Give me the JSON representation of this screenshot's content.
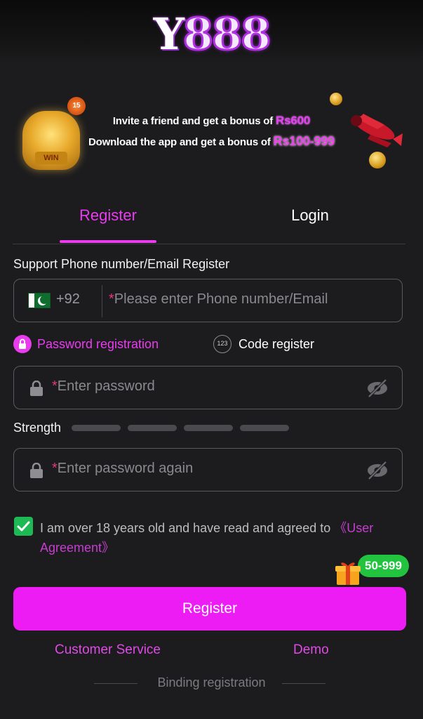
{
  "brand": {
    "logo_text_y": "Y",
    "logo_text_num": "888"
  },
  "banner": {
    "line1_prefix": "Invite a friend and get a bonus of ",
    "line1_amount": "Rs600",
    "line2_prefix": "Download the app and get a bonus of ",
    "line2_amount": "Rs100-999",
    "medal_text": "WIN",
    "badge_text": "15"
  },
  "tabs": [
    {
      "label": "Register",
      "active": true
    },
    {
      "label": "Login",
      "active": false
    }
  ],
  "form": {
    "support_label": "Support Phone number/Email Register",
    "country_code": "+92",
    "phone_placeholder": "Please enter Phone number/Email",
    "required_mark": "*",
    "mode_password_label": "Password registration",
    "mode_code_label": "Code register",
    "mode_code_icon_text": "123",
    "password_placeholder": "Enter password",
    "strength_label": "Strength",
    "password_again_placeholder": "Enter password again",
    "agreement_text": "I am over 18 years old and have read and agreed to ",
    "agreement_link": "《User Agreement》",
    "agreement_checked": true,
    "register_button": "Register"
  },
  "promo": {
    "gift_badge": "50-999"
  },
  "footer": {
    "customer_service": "Customer Service",
    "demo": "Demo",
    "binding": "Binding registration"
  },
  "colors": {
    "accent": "#e93cef",
    "button": "#ee1cf4",
    "background": "#1c1c1e",
    "check": "#1db954",
    "badge": "#22c33e"
  },
  "icons": [
    "pakistan-flag-icon",
    "lock-icon",
    "eye-off-icon",
    "checkbox-icon",
    "gift-icon",
    "coin-icon",
    "plane-icon",
    "medal-icon"
  ]
}
